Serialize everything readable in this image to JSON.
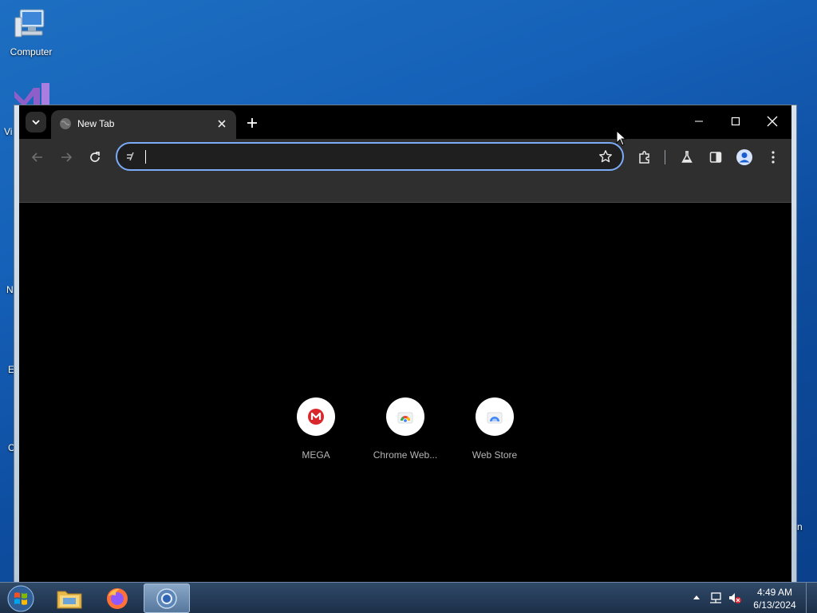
{
  "desktop": {
    "icons": [
      {
        "label": "Computer"
      }
    ],
    "edge_letters": [
      "Vi",
      "N",
      "E",
      "C",
      "n"
    ]
  },
  "browser": {
    "tab": {
      "title": "New Tab"
    },
    "omnibox": {
      "value": "",
      "placeholder": ""
    },
    "shortcuts": [
      {
        "label": "MEGA",
        "icon": "mega-icon",
        "color": "#d9272e"
      },
      {
        "label": "Chrome Web...",
        "icon": "chrome-web-store-icon",
        "color": "#4285f4"
      },
      {
        "label": "Web Store",
        "icon": "web-store-icon",
        "color": "#4285f4"
      }
    ],
    "accent": "#7cacf8"
  },
  "taskbar": {
    "apps": [
      "windows-explorer",
      "firefox",
      "chrome"
    ],
    "clock": {
      "time": "4:49 AM",
      "date": "6/13/2024"
    }
  }
}
